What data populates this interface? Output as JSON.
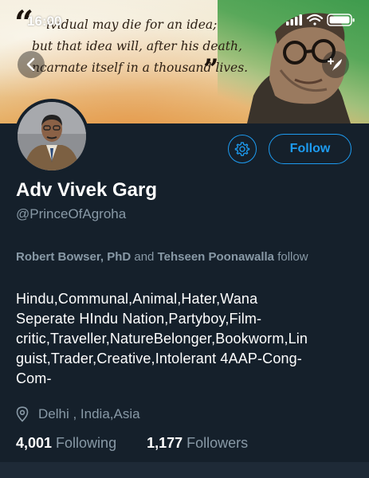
{
  "status_bar": {
    "time": "16:00"
  },
  "banner": {
    "quote_lines": [
      "ividual may die for an idea;",
      "but that idea will, after his death,",
      "ncarnate itself in a thousand lives."
    ],
    "quote_open": "“",
    "quote_close": "”"
  },
  "profile": {
    "display_name": "Adv Vivek Garg",
    "handle": "@PrinceOfAgroha",
    "followed_by": {
      "name1": "Robert Bowser, PhD",
      "conjunction": "and",
      "name2": "Tehseen Poonawalla",
      "suffix": "follow"
    },
    "bio_lines": [
      "Hindu,Communal,Animal,Hater,Wana",
      "Seperate HIndu Nation,Partyboy,Film-",
      "critic,Traveller,NatureBelonger,Bookworm,Lin",
      "guist,Trader,Creative,Intolerant 4AAP-Cong-",
      "Com-"
    ],
    "location": "Delhi , India,Asia",
    "following_count": "4,001",
    "following_label": "Following",
    "followers_count": "1,177",
    "followers_label": "Followers"
  },
  "buttons": {
    "follow_label": "Follow"
  },
  "icons": {
    "back": "chevron-left-icon",
    "compose": "compose-icon",
    "settings": "gear-icon",
    "location": "location-pin-icon",
    "signal": "signal-icon",
    "wifi": "wifi-icon",
    "battery": "battery-icon"
  },
  "colors": {
    "background": "#15202b",
    "accent": "#1d9bf0",
    "secondary_text": "#8899a6",
    "primary_text": "#ffffff"
  }
}
